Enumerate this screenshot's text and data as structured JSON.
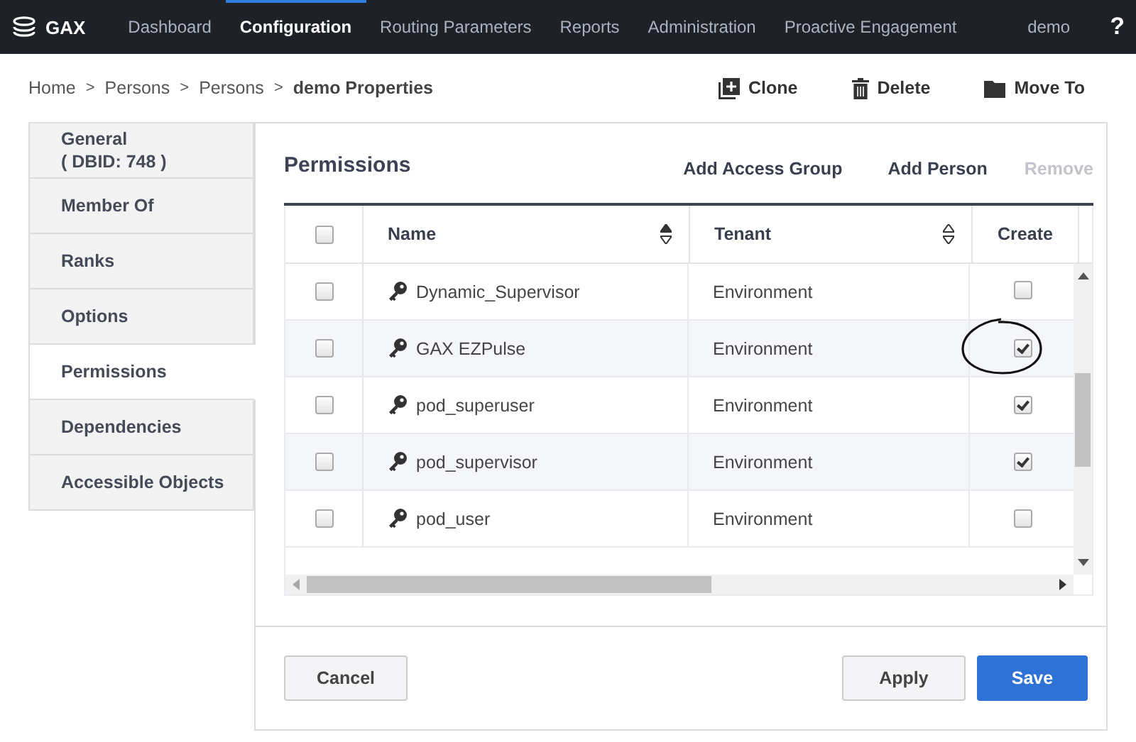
{
  "nav": {
    "brand": "GAX",
    "items": [
      {
        "label": "Dashboard",
        "selected": false
      },
      {
        "label": "Configuration",
        "selected": true
      },
      {
        "label": "Routing Parameters",
        "selected": false
      },
      {
        "label": "Reports",
        "selected": false
      },
      {
        "label": "Administration",
        "selected": false
      },
      {
        "label": "Proactive Engagement",
        "selected": false
      }
    ],
    "user": "demo",
    "help": "?"
  },
  "breadcrumb": [
    "Home",
    "Persons",
    "Persons"
  ],
  "breadcrumb_current": "demo Properties",
  "breadcrumb_separator": ">",
  "actions": [
    {
      "label": "Clone",
      "kind": "clone"
    },
    {
      "label": "Delete",
      "kind": "delete"
    },
    {
      "label": "Move To",
      "kind": "move"
    }
  ],
  "sidebar": {
    "items": [
      {
        "label": "General",
        "sub": "( DBID: 748 )",
        "selected": false
      },
      {
        "label": "Member Of",
        "selected": false
      },
      {
        "label": "Ranks",
        "selected": false
      },
      {
        "label": "Options",
        "selected": false
      },
      {
        "label": "Permissions",
        "selected": true
      },
      {
        "label": "Dependencies",
        "selected": false
      },
      {
        "label": "Accessible Objects",
        "selected": false
      }
    ]
  },
  "section": {
    "title": "Permissions",
    "actions": [
      {
        "label": "Add Access Group",
        "disabled": false
      },
      {
        "label": "Add Person",
        "disabled": false
      },
      {
        "label": "Remove",
        "disabled": true
      }
    ]
  },
  "table": {
    "select_all": false,
    "columns": [
      {
        "label": "Name",
        "sortable": true
      },
      {
        "label": "Tenant",
        "sortable": true
      },
      {
        "label": "Create",
        "sortable": false
      }
    ],
    "rows": [
      {
        "checked": false,
        "name": "Dynamic_Supervisor",
        "tenant": "Environment",
        "create": false,
        "circled": false
      },
      {
        "checked": false,
        "name": "GAX EZPulse",
        "tenant": "Environment",
        "create": true,
        "circled": true
      },
      {
        "checked": false,
        "name": "pod_superuser",
        "tenant": "Environment",
        "create": true,
        "circled": false
      },
      {
        "checked": false,
        "name": "pod_supervisor",
        "tenant": "Environment",
        "create": true,
        "circled": false
      },
      {
        "checked": false,
        "name": "pod_user",
        "tenant": "Environment",
        "create": false,
        "circled": false
      }
    ]
  },
  "footer": {
    "cancel": "Cancel",
    "apply": "Apply",
    "save": "Save"
  }
}
